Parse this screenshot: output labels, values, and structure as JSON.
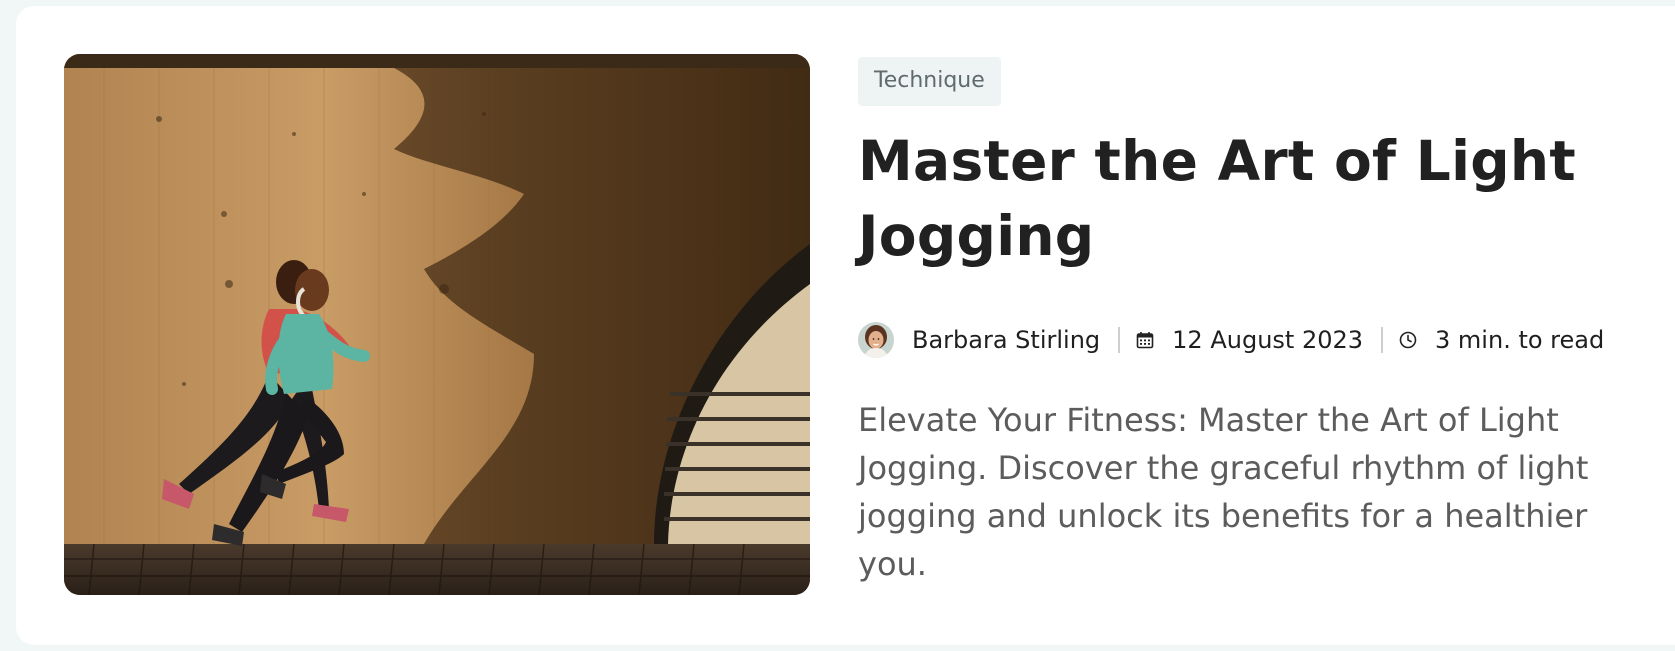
{
  "article": {
    "category": "Technique",
    "title": "Master the Art of Light Jogging",
    "author": "Barbara Stirling",
    "date": "12 August 2023",
    "read_time": "3 min. to read",
    "excerpt": "Elevate Your Fitness: Master the Art of Light Jogging. Discover the graceful rhythm of light jogging and unlock its benefits for a healthier you."
  },
  "icons": {
    "calendar": "calendar-icon",
    "clock": "clock-icon"
  },
  "colors": {
    "page_background": "#f1f6f6",
    "card_background": "#ffffff",
    "tag_background": "#eef4f4",
    "title_text": "#212121",
    "excerpt_text": "#5c5c5c"
  }
}
